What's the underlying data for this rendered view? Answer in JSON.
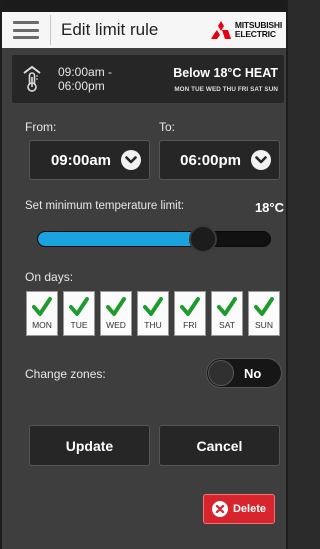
{
  "header": {
    "title": "Edit limit rule",
    "brand_line1": "MITSUBISHI",
    "brand_line2": "ELECTRIC"
  },
  "summary": {
    "time_start": "09:00am -",
    "time_end": "06:00pm",
    "condition": "Below 18°C HEAT",
    "days": "MON TUE WED THU FRI SAT SUN"
  },
  "schedule": {
    "from_label": "From:",
    "to_label": "To:",
    "from_value": "09:00am",
    "to_value": "06:00pm"
  },
  "temperature": {
    "label": "Set minimum temperature limit:",
    "value": "18°C",
    "slider_fraction": 0.71,
    "accent_color": "#1ba3df"
  },
  "days": {
    "label": "On days:",
    "items": [
      {
        "label": "MON",
        "checked": true
      },
      {
        "label": "TUE",
        "checked": true
      },
      {
        "label": "WED",
        "checked": true
      },
      {
        "label": "THU",
        "checked": true
      },
      {
        "label": "FRI",
        "checked": true
      },
      {
        "label": "SAT",
        "checked": true
      },
      {
        "label": "SUN",
        "checked": true
      }
    ],
    "check_color": "#1e9a2e"
  },
  "zones": {
    "label": "Change zones:",
    "toggle_text": "No"
  },
  "actions": {
    "update_label": "Update",
    "cancel_label": "Cancel",
    "delete_label": "Delete",
    "delete_color": "#d7242d"
  },
  "icons": {
    "menu": "hamburger-icon",
    "thermostat": "thermometer-icon",
    "chevron": "chevron-down-icon",
    "check": "check-icon",
    "delete": "close-circle-icon"
  }
}
